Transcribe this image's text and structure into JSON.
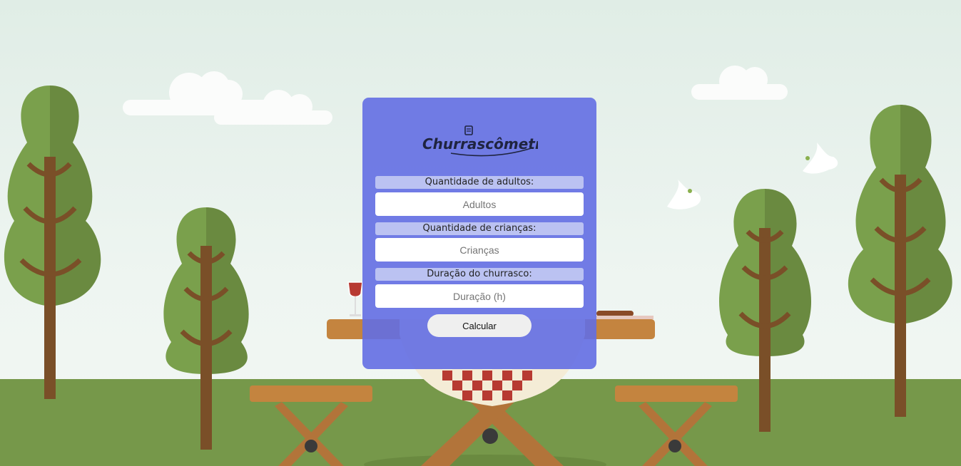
{
  "app": {
    "logo_text": "Churrascômetro"
  },
  "form": {
    "adults": {
      "label": "Quantidade de adultos:",
      "placeholder": "Adultos",
      "value": ""
    },
    "children": {
      "label": "Quantidade de crianças:",
      "placeholder": "Crianças",
      "value": ""
    },
    "duration": {
      "label": "Duração do churrasco:",
      "placeholder": "Duração (h)",
      "value": ""
    },
    "submit_label": "Calcular"
  },
  "colors": {
    "card": "#6f7ce0",
    "grass": "#76984a",
    "tree_light": "#7aa04c",
    "tree_dark": "#6a8a40",
    "trunk": "#7a4f28",
    "wood": "#c4843f",
    "cloth_red": "#b73a32"
  },
  "decor": {
    "background": "park-picnic-scene",
    "icons": [
      "cloud-icon",
      "tree-icon",
      "dove-icon",
      "picnic-table-icon",
      "wine-glass-icon",
      "grill-icon"
    ]
  }
}
